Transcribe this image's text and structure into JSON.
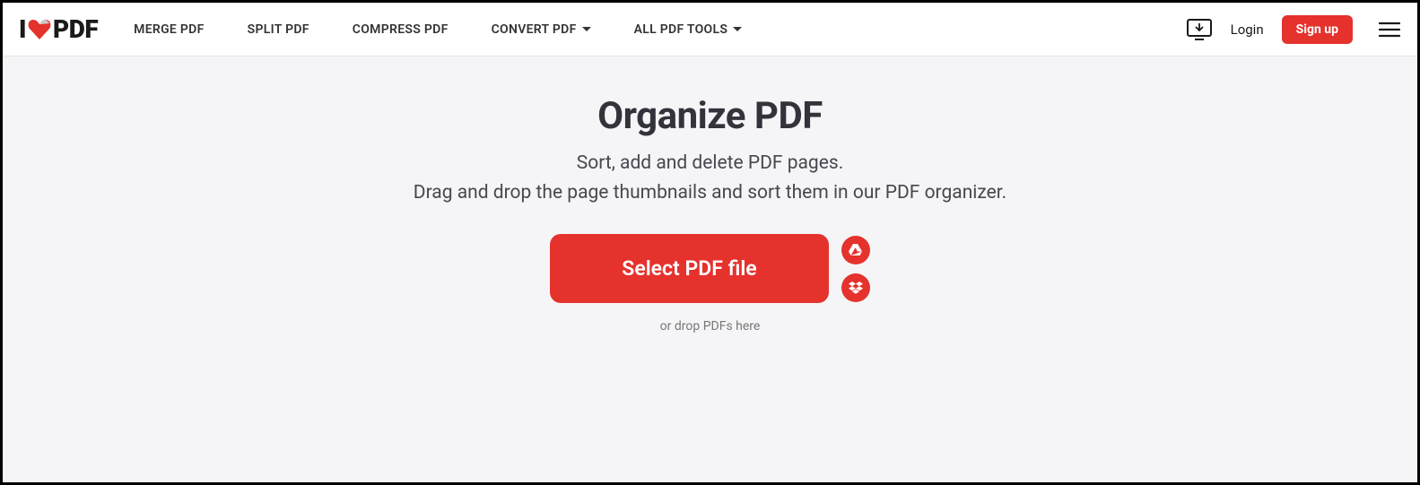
{
  "logo": {
    "prefix": "I",
    "suffix": "PDF"
  },
  "nav": {
    "merge": "MERGE PDF",
    "split": "SPLIT PDF",
    "compress": "COMPRESS PDF",
    "convert": "CONVERT PDF",
    "all_tools": "ALL PDF TOOLS"
  },
  "header": {
    "login": "Login",
    "signup": "Sign up"
  },
  "main": {
    "title": "Organize PDF",
    "subtitle_line1": "Sort, add and delete PDF pages.",
    "subtitle_line2": "Drag and drop the page thumbnails and sort them in our PDF organizer.",
    "select_button": "Select PDF file",
    "drop_hint": "or drop PDFs here"
  }
}
